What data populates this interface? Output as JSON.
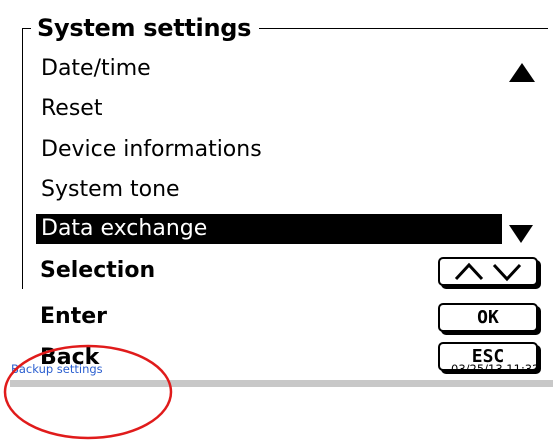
{
  "panel": {
    "title": "System settings"
  },
  "menu": {
    "items": [
      {
        "label": "Date/time"
      },
      {
        "label": "Reset"
      },
      {
        "label": "Device informations"
      },
      {
        "label": "System tone"
      },
      {
        "label": "Data exchange",
        "selected": true
      }
    ],
    "scroll_up_icon": "triangle-up",
    "scroll_down_icon": "triangle-down"
  },
  "keys": {
    "selection_label": "Selection",
    "selection_icon": "up-down-arrows",
    "enter_label": "Enter",
    "enter_key": "OK",
    "back_label": "Back",
    "back_key": "ESC"
  },
  "status": {
    "text": "Backup settings",
    "datetime": "03/25/13 11:32"
  },
  "colors": {
    "status_text": "#2b5fd0",
    "highlight_circle": "#e01b1b",
    "selection_bg": "#000000"
  }
}
